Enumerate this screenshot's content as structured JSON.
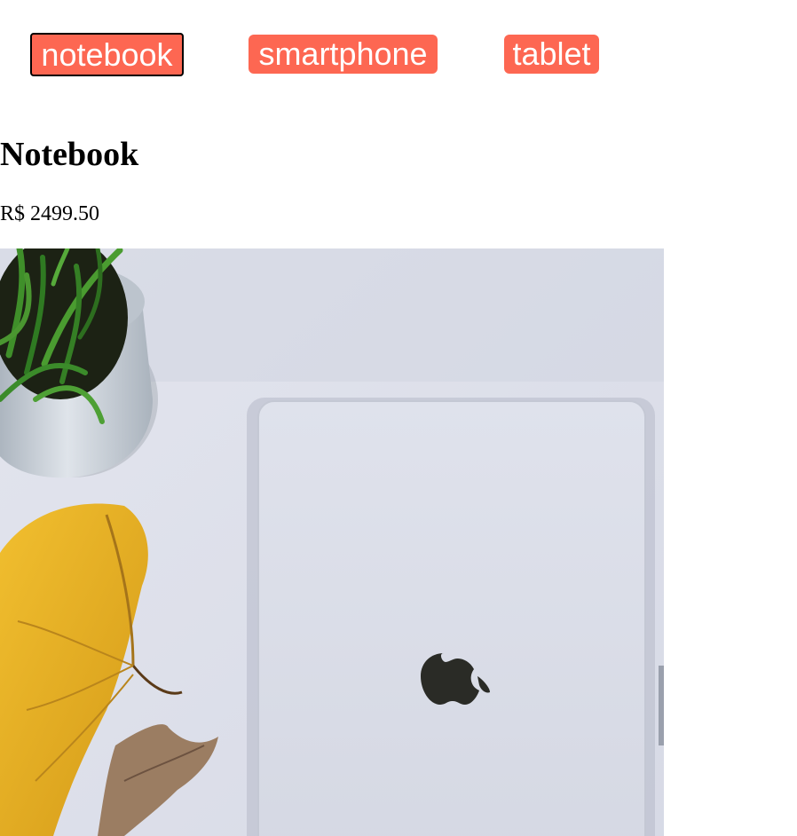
{
  "nav": {
    "buttons": [
      {
        "label": "notebook",
        "active": true
      },
      {
        "label": "smartphone",
        "active": false
      },
      {
        "label": "tablet",
        "active": false
      }
    ]
  },
  "product": {
    "title": "Notebook",
    "price": "R$ 2499.50",
    "image_icon": "laptop-photo"
  },
  "colors": {
    "button_bg": "#fd6752",
    "button_text": "#ffffff",
    "active_outline": "#000000"
  }
}
